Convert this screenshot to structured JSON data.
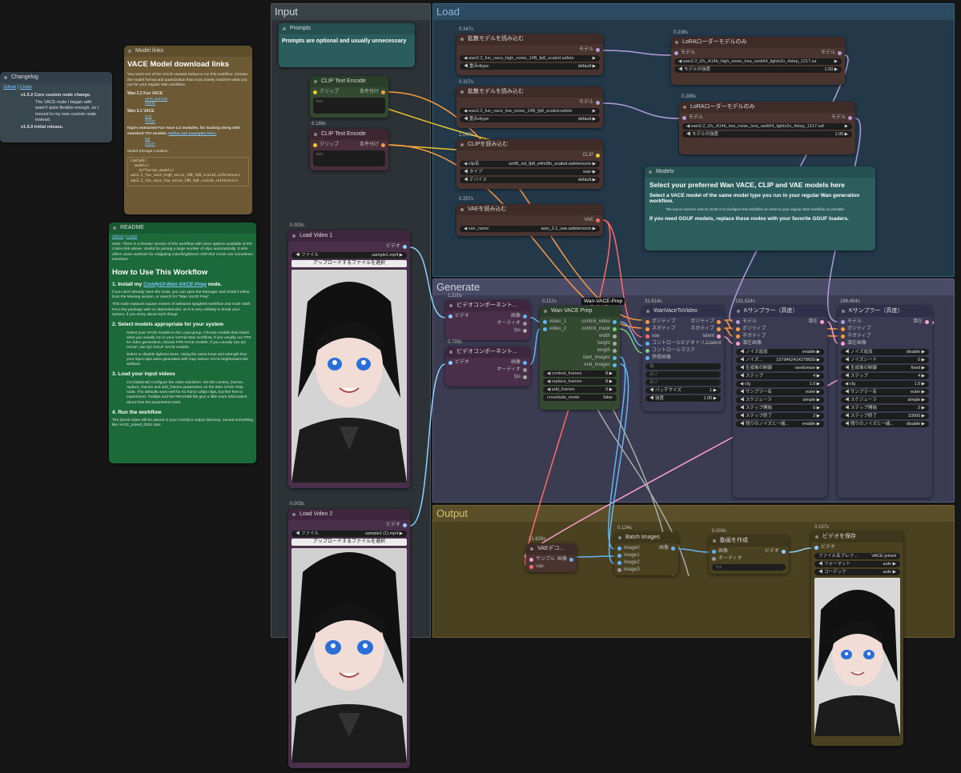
{
  "groups": {
    "input": "Input",
    "load": "Load",
    "generate": "Generate",
    "output": "Output"
  },
  "colors": {
    "input_group": "#2d3436",
    "load_group": "#243a48",
    "generate_group": "#3c3d52",
    "output_group": "#4b4220",
    "note_brown": "#6e5b34",
    "note_teal": "#2b5e5e",
    "readme_green": "#1d6a3a",
    "purple_node": "#4a2f4a",
    "brown_node": "#4a3430",
    "green_node": "#334a30"
  },
  "changelog": {
    "title": "Changelog",
    "links": [
      "Github",
      "Civitai"
    ],
    "items": [
      "v1.0.2 Core custom node change.",
      "The VACE node I began with wasn't quite flexible enough, so I moved to my own custom node instead.",
      "v1.0.0 Initial release."
    ]
  },
  "model_links": {
    "title": "Model links",
    "heading": "VACE Model download links",
    "intro": "You need one of the VACE variants below to run this workflow. Choose the model format and quantization that most closely matches what you run for your regular Wan workflow.",
    "wan22": "Wan 2.2 Fun VACE",
    "wan22_links": [
      "HF/K and bulk",
      "GGUF"
    ],
    "wan21": "Wan 2.1 VACE",
    "wan21_links": [
      "fp16",
      "GGUF"
    ],
    "kijai": "Kijai's extracted Fun Vace 2.2 modules, for loading along with standard T2V models.",
    "kijai_link": "Native use examples here.",
    "kijai_links": [
      "fp8",
      "GGUF"
    ],
    "storage": "Model Storage Location",
    "tree": [
      "ComfyUI/",
      "  models/",
      "    diffusion_models/",
      "wan2.2_fun_vace_high_noise_14B_fp8_scaled.safetensors",
      "wan2.2_fun_vace_low_noise_14B_fp8_scaled.safetensors"
    ]
  },
  "readme": {
    "title": "README",
    "links": [
      "Github",
      "Civitai"
    ],
    "note": "Note: There is a heavier version of this workflow with more options available at the CivitAI link above. Useful for joining a large number of clips automatically. It also offers some methods for mitigating color/brightness shift that VACE can sometimes introduce.",
    "h1": "How to Use This Workflow",
    "s1": "1. Install my ",
    "s1_link": "ComfyUI-Wan-VACE-Prep",
    "s1_tail": " node.",
    "p1": "If you don't already have the node, you can open the Manager and install it either from the Missing section, or search for \"Wan VACE Prep\".",
    "p1b": "This node replaces square meters of awkward spaghetti workflow and node math. It's a tiny package with no dependencies, so it is very unlikely to break your system, if you worry about such things.",
    "s2": "2. Select models appropriate for your system",
    "p2a": "Select your VACE models in the Load group. Choose models that match what you usually run in your normal Wan workflow. If you usually run FP8 for video generation, choose FP8 VACE models. If you usually use Q4 GGUF, use Q4 GGUF VACE models.",
    "p2b": "Select or disable lightx2v loras. Using the same loras and strength that your input clips were generated with may reduce VACE brightness/color artifacts.",
    "s3": "3. Load your input videos",
    "p3": "3.5 (Optional) Configure the video transition. Set the context_frames, replace_frames and add_frames parameters on the Wan VACE Prep node. The defaults work well for 81 frame 16fps clips, but feel free to experiment. Tooltips and the README file give a little more information about how the parameters work.",
    "s4": "4. Run the workflow",
    "p4": "The joined video will be placed in your ComfyUI output directory, named something like VACE_joined_0001.mp4"
  },
  "prompts_note": {
    "title": "Prompts",
    "text": "Prompts are optional and usually unnecessary"
  },
  "clip1": {
    "title": "CLIP Text Encode",
    "in": "クリップ",
    "out": "条件付け",
    "placeholder": "text"
  },
  "clip2": {
    "timing": "6.188s",
    "title": "CLIP Text Encode",
    "in": "クリップ",
    "out": "条件付け",
    "placeholder": "text"
  },
  "video1": {
    "timing": "0.003s",
    "title": "Load Video 1",
    "out": "ビデオ",
    "file_label": "ファイル",
    "file": "sample1.mp4",
    "upload": "アップロードするファイルを選択"
  },
  "video2": {
    "timing": "0.003s",
    "title": "Load Video 2",
    "out": "ビデオ",
    "file_label": "ファイル",
    "file": "sample2 (1).mp4",
    "upload": "アップロードするファイルを選択"
  },
  "diff1": {
    "timing": "0.347s",
    "title": "拡散モデルを読み込む",
    "out": "モデル",
    "model": "wan2.2_fun_vace_high_noise_14B_fp8_scaled.safete",
    "dtype_label": "重みdtype",
    "dtype": "default"
  },
  "diff2": {
    "timing": "0.327s",
    "title": "拡散モデルを読み込む",
    "out": "モデル",
    "model": "wan2.2_fun_vace_low_noise_14B_fp8_scaled.safete",
    "dtype_label": "重みdtype",
    "dtype": "default"
  },
  "clipload": {
    "timing": "1.047s",
    "title": "CLIPを読み込む",
    "out": "CLIP",
    "name_label": "clip名",
    "name": "umt5_xxl_fp8_e4m3fn_scaled.safetensors",
    "type_label": "タイプ",
    "type": "wan",
    "device_label": "デバイス",
    "device": "default"
  },
  "vaeload": {
    "timing": "0.257s",
    "title": "VAEを読み込む",
    "out": "VAE",
    "name_label": "vae_name",
    "name": "wan_2.1_vae.safetensors"
  },
  "lora1": {
    "timing": "0.238s",
    "title": "LoRAローダーモデルのみ",
    "in": "モデル",
    "out": "モデル",
    "name": "wan2.2_t2v_A14b_high_noise_lora_rank64_lightx2v_4step_1217.sa",
    "strength_label": "モデルの強度",
    "strength": "1.00"
  },
  "lora2": {
    "timing": "0.288s",
    "title": "LoRAローダーモデルのみ",
    "in": "モデル",
    "out": "モデル",
    "name": "wan2.2_t2v_A14b_low_noise_lora_rank64_lightx2v_4step_1217.saf",
    "strength_label": "モデルの強度",
    "strength": "1.00"
  },
  "models_note": {
    "title": "Models",
    "heading": "Select your preferred Wan VACE, CLIP and VAE models here",
    "p1": "Select a VACE model of the same model type you run in your regular Wan generation workflow.",
    "bullet": "The key to success and no OOM is to configure this workflow as close to your regular Wan workflow as possible.",
    "p2": "If you need GGUF models, replace these nodes with your favorite GGUF loaders."
  },
  "comp1": {
    "timing": "1.220s",
    "title": "ビデオコンポーネント...",
    "in": "ビデオ",
    "outs": [
      "画像",
      "オーディオ",
      "fps"
    ]
  },
  "comp2": {
    "timing": "0.793s",
    "title": "ビデオコンポーネント...",
    "in": "ビデオ",
    "outs": [
      "画像",
      "オーディオ",
      "fps"
    ]
  },
  "prep": {
    "timing": "0.112s",
    "badge": "Wan-VACE-Prep",
    "title": "Wan VACE Prep",
    "ins": [
      "video_1",
      "video_2"
    ],
    "outs": [
      "control_video",
      "control_mask",
      "width",
      "height",
      "length",
      "start_images",
      "end_images"
    ],
    "w": [
      {
        "label": "context_frames",
        "value": "8"
      },
      {
        "label": "replace_frames",
        "value": "8"
      },
      {
        "label": "add_frames",
        "value": "0"
      },
      {
        "label": "crossfade_mode",
        "value": "false"
      }
    ]
  },
  "wanvace": {
    "timing": "32.614s",
    "title": "WanVaceToVideo",
    "ins": [
      "ポジティブ",
      "ネガティブ",
      "vae",
      "コントロールビデオ",
      "コントロールマスク",
      "参照画像"
    ],
    "outs": [
      "ポジティブ",
      "ネガティブ",
      "latent",
      "トリムlatent"
    ],
    "dim": [
      "幅",
      "高さ",
      "長さ"
    ],
    "w": [
      {
        "label": "バッチサイズ",
        "value": "1"
      },
      {
        "label": "強度",
        "value": "1.00"
      }
    ]
  },
  "ks1": {
    "timing": "191.524s",
    "title": "Kサンプラー（高度）",
    "ins": [
      "モデル",
      "ポジティブ",
      "ネガティブ",
      "潜在画像"
    ],
    "out": "潜在",
    "w": [
      {
        "label": "ノイズ追加",
        "value": "enable"
      },
      {
        "label": "ノイズ...",
        "value": "1079462414278659"
      },
      {
        "label": "生成後の制御",
        "value": "randomize"
      },
      {
        "label": "ステップ",
        "value": "4"
      },
      {
        "label": "cfg",
        "value": "1.0"
      },
      {
        "label": "サンプラー名",
        "value": "euler"
      },
      {
        "label": "スケジューラ",
        "value": "simple"
      },
      {
        "label": "ステップ開始",
        "value": "0"
      },
      {
        "label": "ステップ終了",
        "value": "2"
      },
      {
        "label": "残りのノイズと一緒...",
        "value": "enable"
      }
    ]
  },
  "ks2": {
    "timing": "186.484s",
    "title": "Kサンプラー（高度）",
    "ins": [
      "モデル",
      "ポジティブ",
      "ネガティブ",
      "潜在画像"
    ],
    "out": "潜在",
    "w": [
      {
        "label": "ノイズ追加",
        "value": "disable"
      },
      {
        "label": "ノイズシード",
        "value": "0"
      },
      {
        "label": "生成後の制御",
        "value": "fixed"
      },
      {
        "label": "ステップ",
        "value": "4"
      },
      {
        "label": "cfg",
        "value": "1.0"
      },
      {
        "label": "サンプラー名",
        "value": "euler"
      },
      {
        "label": "スケジューラ",
        "value": "simple"
      },
      {
        "label": "ステップ開始",
        "value": "2"
      },
      {
        "label": "ステップ終了",
        "value": "10000"
      },
      {
        "label": "残りのノイズと一緒...",
        "value": "disable"
      }
    ]
  },
  "vaedec": {
    "timing": "21.628s",
    "title": "VAEデコ...",
    "ins": [
      "サンプル",
      "vae"
    ],
    "out": "画像"
  },
  "batch": {
    "timing": "0.134s",
    "title": "Batch Images",
    "ins": [
      "image0",
      "image1",
      "image2",
      "image3"
    ],
    "out": "画像"
  },
  "mkvideo": {
    "timing": "0.004s",
    "title": "動画を作成",
    "ins": [
      "画像",
      "オーディオ"
    ],
    "out": "ビデオ",
    "fps_label": "fps"
  },
  "save": {
    "timing": "3.157s",
    "title": "ビデオを保存",
    "in": "ビデオ",
    "w": [
      {
        "label": "ファイル名プレフ...",
        "value": "VACE joined"
      },
      {
        "label": "フォーマット",
        "value": "auto"
      },
      {
        "label": "コーデック",
        "value": "auto"
      }
    ]
  }
}
